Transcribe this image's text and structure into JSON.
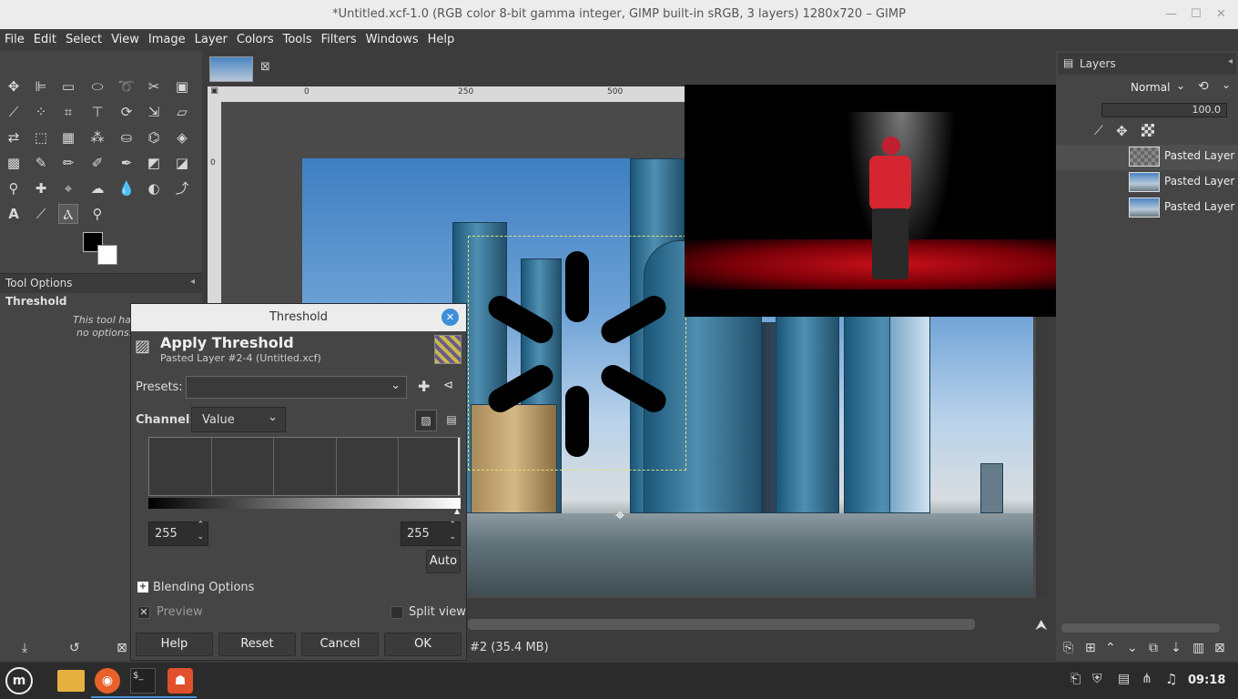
{
  "window": {
    "title": "*Untitled.xcf-1.0 (RGB color 8-bit gamma integer, GIMP built-in sRGB, 3 layers) 1280x720 – GIMP"
  },
  "menu": [
    "File",
    "Edit",
    "Select",
    "View",
    "Image",
    "Layer",
    "Colors",
    "Tools",
    "Filters",
    "Windows",
    "Help"
  ],
  "ruler": {
    "t0": "0",
    "t250": "250",
    "t500": "500",
    "v0": "0"
  },
  "tool_options": {
    "tab": "Tool Options",
    "tool_name": "Threshold",
    "msg1": "This tool has",
    "msg2": "no options."
  },
  "layers_panel": {
    "tab": "Layers",
    "mode": "Normal",
    "opacity": "100.0",
    "items": [
      {
        "name": "Pasted Layer #"
      },
      {
        "name": "Pasted Layer #"
      },
      {
        "name": "Pasted Layer"
      }
    ]
  },
  "dialog": {
    "title": "Threshold",
    "heading": "Apply Threshold",
    "subheading": "Pasted Layer #2-4 (Untitled.xcf)",
    "presets_label": "Presets:",
    "channel_label": "Channel:",
    "channel_value": "Value",
    "low": "255",
    "high": "255",
    "auto": "Auto",
    "blending": "Blending Options",
    "preview": "Preview",
    "split_view": "Split view",
    "help": "Help",
    "reset": "Reset",
    "cancel": "Cancel",
    "ok": "OK"
  },
  "status": {
    "text": "#2 (35.4 MB)"
  },
  "taskbar": {
    "clock": "09:18"
  },
  "colors": {
    "accent": "#3d8fd9",
    "dialog_bg": "#454545",
    "taskbar": "#2b2b2b"
  }
}
